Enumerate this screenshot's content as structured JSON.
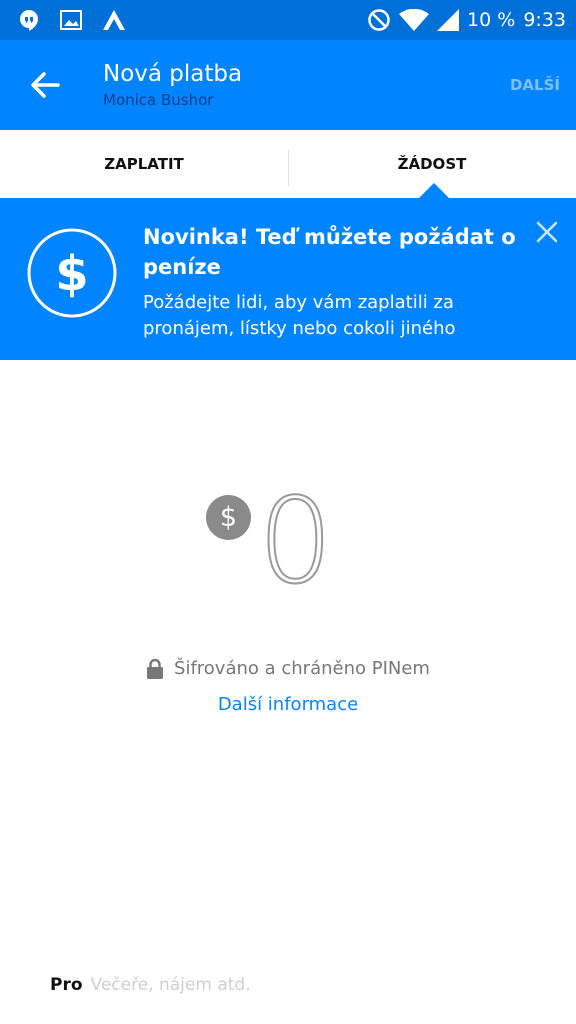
{
  "status_bar": {
    "battery": "10 %",
    "time": "9:33",
    "icons": [
      "hangouts-icon",
      "gallery-icon",
      "app-a-icon",
      "dnd-icon",
      "wifi-icon",
      "signal-icon",
      "battery-icon"
    ]
  },
  "app_bar": {
    "title": "Nová platba",
    "subtitle": "Monica Bushor",
    "next_label": "DALŠÍ"
  },
  "tabs": [
    {
      "label": "ZAPLATIT",
      "active": false
    },
    {
      "label": "ŽÁDOST",
      "active": true
    }
  ],
  "banner": {
    "title": "Novinka! Teď můžete požádat o peníze",
    "text": "Požádejte lidi, aby vám zaplatili za pronájem, lístky nebo cokoli jiného"
  },
  "amount": {
    "currency": "$",
    "value": "0"
  },
  "security": {
    "text": "Šifrováno a chráněno PINem",
    "link": "Další informace"
  },
  "memo": {
    "label": "Pro",
    "placeholder": "Večeře, nájem atd."
  },
  "colors": {
    "primary": "#0084ff",
    "status_bar": "#0070d9",
    "link": "#0a84ff"
  }
}
